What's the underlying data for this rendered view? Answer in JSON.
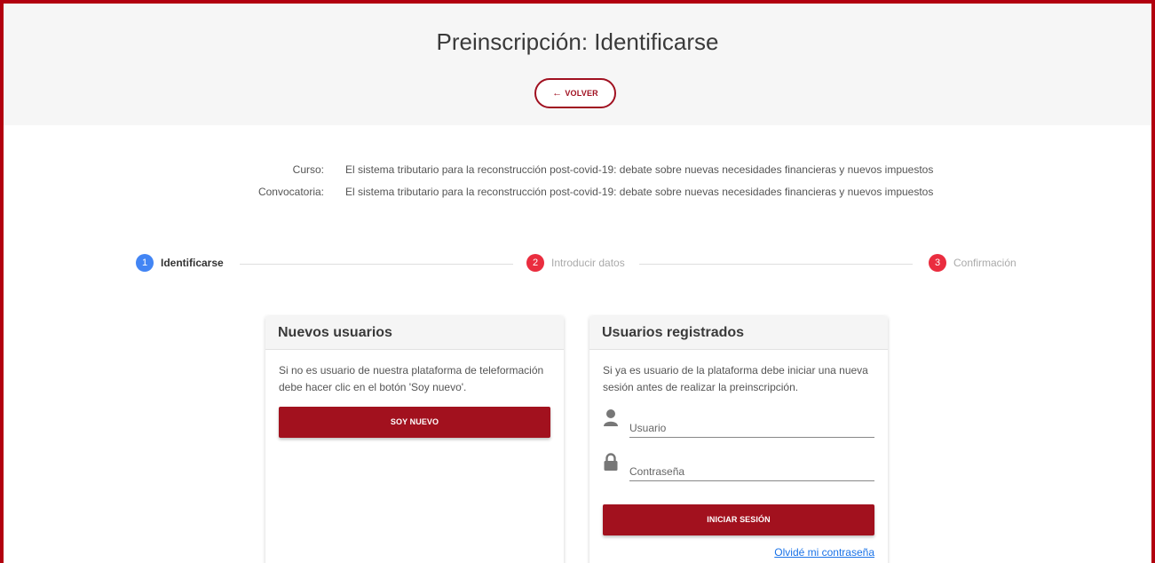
{
  "page_title": "Preinscripción: Identificarse",
  "back_button": {
    "icon": "arrow-left-icon",
    "arrow": "←",
    "label": "VOLVER"
  },
  "info": {
    "course_label": "Curso:",
    "course_value": "El sistema tributario para la reconstrucción post-covid-19: debate sobre nuevas necesidades financieras y nuevos impuestos",
    "call_label": "Convocatoria:",
    "call_value": "El sistema tributario para la reconstrucción post-covid-19: debate sobre nuevas necesidades financieras y nuevos impuestos"
  },
  "steps": [
    {
      "number": "1",
      "label": "Identificarse",
      "state": "active",
      "color": "#4285f4"
    },
    {
      "number": "2",
      "label": "Introducir datos",
      "state": "pending",
      "color": "#ea2d3f"
    },
    {
      "number": "3",
      "label": "Confirmación",
      "state": "pending",
      "color": "#ea2d3f"
    }
  ],
  "new_users": {
    "title": "Nuevos usuarios",
    "description": "Si no es usuario de nuestra plataforma de teleformación debe hacer clic en el botón 'Soy nuevo'.",
    "button_label": "SOY NUEVO"
  },
  "registered_users": {
    "title": "Usuarios registrados",
    "description": "Si ya es usuario de la plataforma debe iniciar una nueva sesión antes de realizar la preinscripción.",
    "username_placeholder": "Usuario",
    "username_icon": "user-icon",
    "password_placeholder": "Contraseña",
    "password_icon": "lock-icon",
    "login_button_label": "INICIAR SESIÓN",
    "forgot_link": "Olvidé mi contraseña"
  },
  "colors": {
    "brand": "#a2111e",
    "frame_border": "#b2000f",
    "step_active": "#4285f4",
    "step_pending": "#ea2d3f",
    "link": "#1a73e8"
  }
}
